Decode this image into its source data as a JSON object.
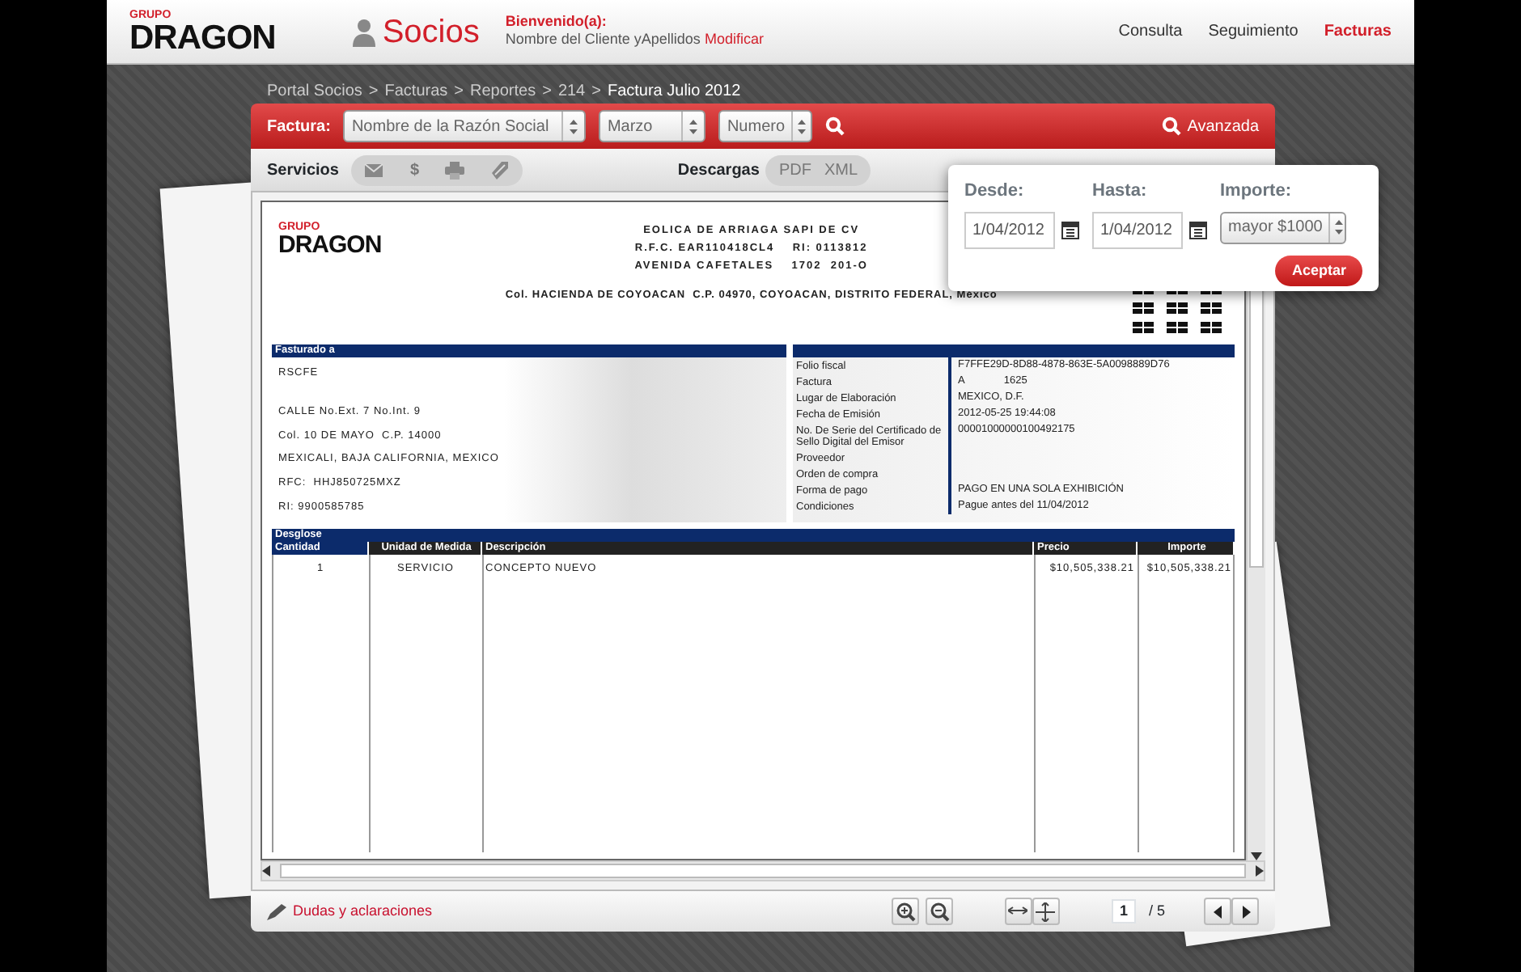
{
  "header": {
    "logo_small": "GRUPO",
    "logo_main": "DRAGON",
    "section_title": "Socios",
    "welcome": "Bienvenido(a):",
    "user_name": "Nombre del Cliente yApellidos",
    "modify_link": "Modificar",
    "nav": [
      {
        "label": "Consulta",
        "selected": false
      },
      {
        "label": "Seguimiento",
        "selected": false
      },
      {
        "label": "Facturas",
        "selected": true
      }
    ]
  },
  "breadcrumb": {
    "separator": ">",
    "items": [
      "Portal Socios",
      "Facturas",
      "Reportes",
      "214",
      "Factura Julio 2012"
    ]
  },
  "toolbar": {
    "label": "Factura:",
    "selects": [
      {
        "value": "Nombre de la Razón Social"
      },
      {
        "value": "Marzo"
      },
      {
        "value": "Numero"
      }
    ],
    "advanced": "Avanzada"
  },
  "subtoolbar": {
    "services_label": "Servicios",
    "services": [
      {
        "kind": "mail"
      },
      {
        "kind": "glyph",
        "text": "$"
      },
      {
        "kind": "print"
      },
      {
        "kind": "tag"
      }
    ],
    "downloads_label": "Descargas",
    "downloads": [
      "PDF",
      "XML"
    ]
  },
  "filter_popup": {
    "from": {
      "label": "Desde:",
      "value": "1/04/2012"
    },
    "to": {
      "label": "Hasta:",
      "value": "1/04/2012"
    },
    "amount": {
      "label": "Importe:",
      "value": "mayor $1000"
    },
    "button": "Aceptar"
  },
  "invoice": {
    "logo_small": "GRUPO",
    "logo_main": "DRAGON",
    "issuer_lines": [
      "EOLICA DE ARRIAGA SAPI DE CV",
      "R.F.C. EAR110418CL4    RI: 0113812",
      "AVENIDA CAFETALES    1702  201-O"
    ],
    "issuer_address": "Col. HACIENDA DE COYOACAN  C.P. 04970, COYOACAN, DISTRITO FEDERAL, México",
    "billed_to_title": "Fasturado a",
    "billed_to_lines": [
      "RSCFE",
      "CALLE No.Ext. 7 No.Int. 9",
      "Col. 10 DE MAYO  C.P. 14000",
      "MEXICALI, BAJA CALIFORNIA, MEXICO",
      "RFC:  HHJ850725MXZ",
      "RI: 9900585785"
    ],
    "details": [
      {
        "label": "Folio fiscal",
        "value": "F7FFE29D-8D88-4878-863E-5A0098889D76"
      },
      {
        "label": "Factura",
        "value": "A",
        "value_2": "1625"
      },
      {
        "label": "Lugar de Elaboración",
        "value": "MEXICO, D.F."
      },
      {
        "label": "Fecha de Emisión",
        "value": "2012-05-25 19:44:08"
      },
      {
        "label": "No. De Serie del Certificado de Sello Digital del Emisor",
        "value": "00001000000100492175"
      },
      {
        "label": "Proveedor"
      },
      {
        "label": "Orden de compra"
      },
      {
        "label": "Forma de pago",
        "value": "PAGO EN UNA SOLA EXHIBICIÓN"
      },
      {
        "label": "Condiciones",
        "value": "Pague antes del 11/04/2012"
      }
    ],
    "breakdown_title": "Desglose",
    "columns": [
      "Cantidad",
      "Unidad de Medida",
      "Descripción",
      "Precio",
      "Importe"
    ],
    "rows": [
      [
        "1",
        "SERVICIO",
        "CONCEPTO NUEVO",
        "$10,505,338.21",
        "$10,505,338.21"
      ]
    ]
  },
  "footer": {
    "help_link": "Dudas y aclaraciones",
    "page_current": "1",
    "page_total": "/ 5"
  }
}
